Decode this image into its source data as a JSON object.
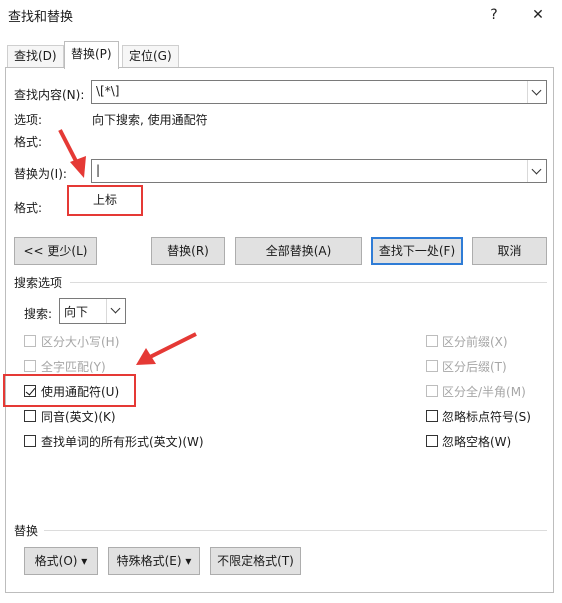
{
  "window": {
    "title": "查找和替换",
    "help": "?",
    "close": "✕"
  },
  "tabs": [
    {
      "label": "查找(D)"
    },
    {
      "label": "替换(P)"
    },
    {
      "label": "定位(G)"
    }
  ],
  "find": {
    "label": "查找内容(N):",
    "value": "\\[*\\]"
  },
  "options": {
    "label": "选项:",
    "value": "向下搜索, 使用通配符"
  },
  "find_format": {
    "label": "格式:"
  },
  "replace": {
    "label": "替换为(I):",
    "value": "|"
  },
  "replace_format": {
    "label": "格式:",
    "value": "上标"
  },
  "buttons": {
    "less": "<< 更少(L)",
    "replace": "替换(R)",
    "replace_all": "全部替换(A)",
    "find_next": "查找下一处(F)",
    "cancel": "取消"
  },
  "search_options": {
    "title": "搜索选项",
    "search_label": "搜索:",
    "search_value": "向下"
  },
  "checkboxes_left": [
    {
      "label": "区分大小写(H)",
      "checked": false,
      "enabled": false
    },
    {
      "label": "全字匹配(Y)",
      "checked": false,
      "enabled": false
    },
    {
      "label": "使用通配符(U)",
      "checked": true,
      "enabled": true
    },
    {
      "label": "同音(英文)(K)",
      "checked": false,
      "enabled": true
    },
    {
      "label": "查找单词的所有形式(英文)(W)",
      "checked": false,
      "enabled": true
    }
  ],
  "checkboxes_right": [
    {
      "label": "区分前缀(X)",
      "checked": false,
      "enabled": false
    },
    {
      "label": "区分后缀(T)",
      "checked": false,
      "enabled": false
    },
    {
      "label": "区分全/半角(M)",
      "checked": false,
      "enabled": false
    },
    {
      "label": "忽略标点符号(S)",
      "checked": false,
      "enabled": true
    },
    {
      "label": "忽略空格(W)",
      "checked": false,
      "enabled": true
    }
  ],
  "replace_section": {
    "title": "替换",
    "format_btn": "格式(O) ▾",
    "special_btn": "特殊格式(E) ▾",
    "no_format_btn": "不限定格式(T)"
  },
  "colors": {
    "accent": "#2f7cd6",
    "annotation": "#e53935"
  }
}
